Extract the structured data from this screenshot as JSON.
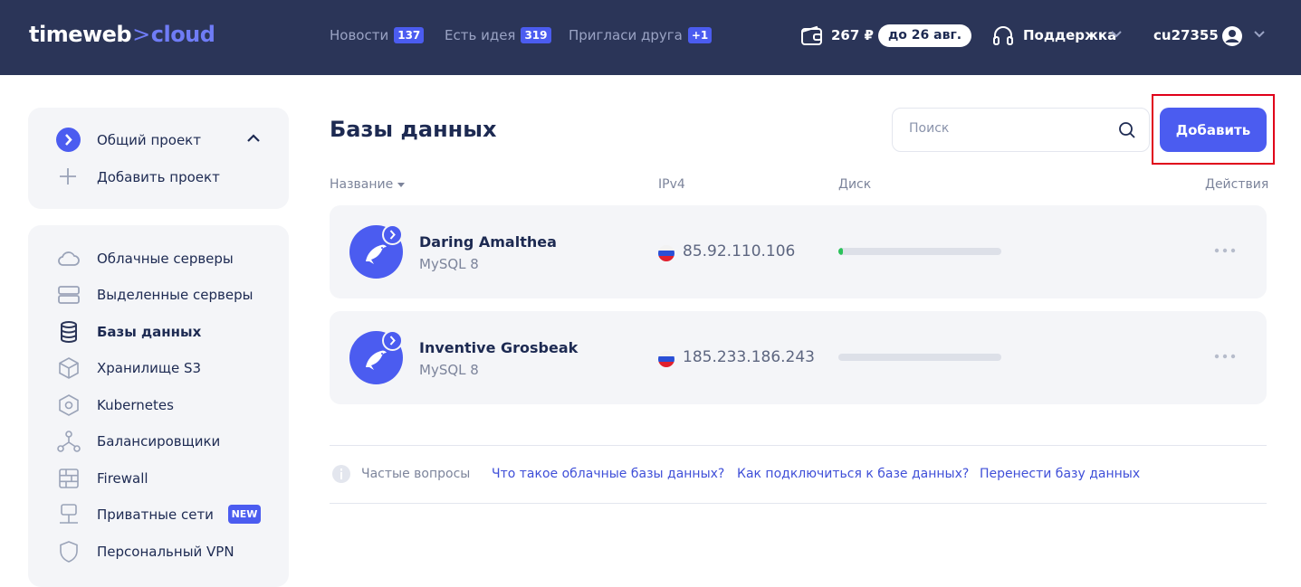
{
  "header": {
    "logo_main": "timeweb",
    "logo_chevron": ">",
    "logo_accent": "cloud",
    "nav": [
      {
        "label": "Новости",
        "badge": "137"
      },
      {
        "label": "Есть идея",
        "badge": "319"
      },
      {
        "label": "Пригласи друга",
        "badge": "+1"
      }
    ],
    "balance": "267 ₽",
    "due_label": "до 26 авг.",
    "support_label": "Поддержка",
    "username": "cu27355",
    "icons": [
      "wallet-icon",
      "headset-icon",
      "user-avatar-icon",
      "chevron-down-icon"
    ]
  },
  "sidebar": {
    "project": {
      "name": "Общий проект",
      "add_label": "Добавить проект"
    },
    "items": [
      {
        "label": "Облачные серверы",
        "icon": "cloud-icon"
      },
      {
        "label": "Выделенные серверы",
        "icon": "server-icon"
      },
      {
        "label": "Базы данных",
        "icon": "database-icon",
        "active": true
      },
      {
        "label": "Хранилище S3",
        "icon": "cube-icon"
      },
      {
        "label": "Kubernetes",
        "icon": "kubernetes-icon"
      },
      {
        "label": "Балансировщики",
        "icon": "balancer-icon"
      },
      {
        "label": "Firewall",
        "icon": "firewall-icon"
      },
      {
        "label": "Приватные сети",
        "icon": "network-icon",
        "badge": "NEW"
      },
      {
        "label": "Персональный VPN",
        "icon": "shield-icon"
      }
    ]
  },
  "main": {
    "title": "Базы данных",
    "search_placeholder": "Поиск",
    "add_button": "Добавить",
    "columns": {
      "name": "Название",
      "ipv4": "IPv4",
      "disk": "Диск",
      "actions": "Действия"
    },
    "databases": [
      {
        "name": "Daring Amalthea",
        "type": "MySQL 8",
        "ip": "85.92.110.106",
        "disk_fraction": 0.03
      },
      {
        "name": "Inventive Grosbeak",
        "type": "MySQL 8",
        "ip": "185.233.186.243",
        "disk_fraction": 0
      }
    ],
    "faq": {
      "label": "Частые вопросы",
      "links": [
        "Что такое облачные базы данных?",
        "Как подключиться к базе данных?",
        "Перенести базу данных"
      ]
    }
  },
  "colors": {
    "header_bg": "#2b3558",
    "accent": "#4b5cf0",
    "highlight_outline": "#e0001a",
    "disk_used": "#2bc25a"
  }
}
